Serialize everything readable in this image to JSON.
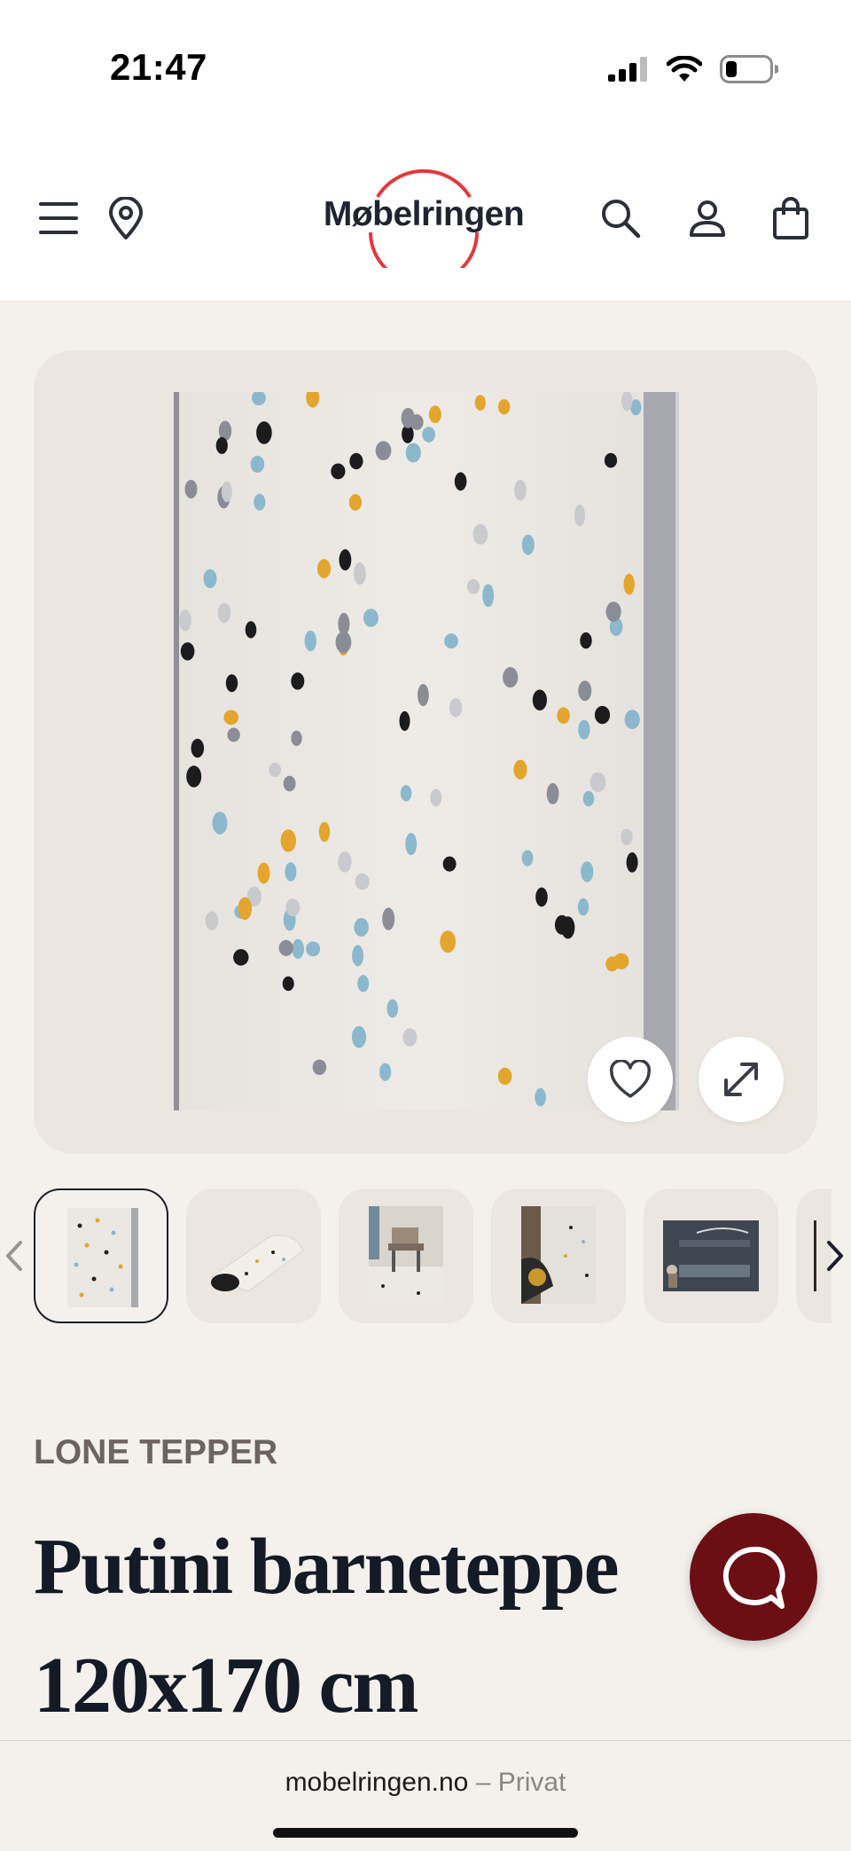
{
  "status_bar": {
    "time": "21:47"
  },
  "header": {
    "logo_text": "Møbelringen",
    "icons": [
      "menu-icon",
      "location-pin-icon",
      "search-icon",
      "user-icon",
      "shopping-bag-icon"
    ],
    "brand_color": "#e0393e"
  },
  "gallery": {
    "image_alt": "Putini barneteppe",
    "favorite_icon": "heart-icon",
    "expand_icon": "expand-icon",
    "thumbnails": [
      {
        "name": "rug-flat",
        "selected": true
      },
      {
        "name": "rug-rolled",
        "selected": false
      },
      {
        "name": "rug-room-playtable",
        "selected": false
      },
      {
        "name": "rug-room-floor",
        "selected": false
      },
      {
        "name": "rug-room-bunkbed",
        "selected": false
      }
    ]
  },
  "product": {
    "brand": "LONE TEPPER",
    "title_line1": "Putini barneteppe",
    "title_line2": "120x170 cm"
  },
  "chat": {
    "icon": "chat-bubble-icon",
    "color": "#6b0f14"
  },
  "browser": {
    "domain": "mobelringen.no",
    "separator": "–",
    "mode": "Privat"
  }
}
